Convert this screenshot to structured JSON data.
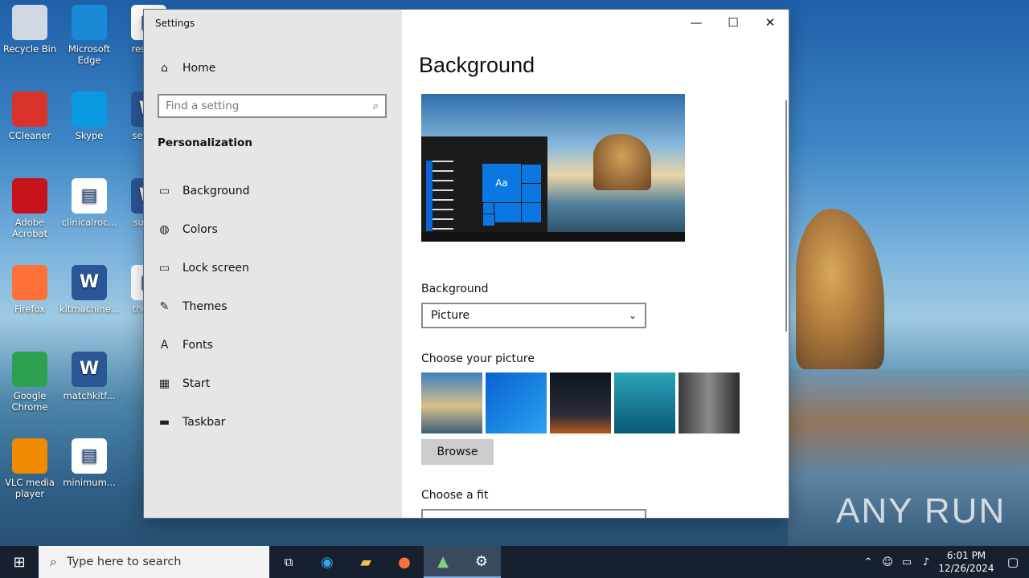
{
  "desktop": {
    "icons": [
      {
        "label": "Recycle Bin",
        "icon": "recycle-bin-icon",
        "color": "#cfd8e3"
      },
      {
        "label": "Microsoft Edge",
        "icon": "edge-icon",
        "color": "#1b8ad6"
      },
      {
        "label": "respe...",
        "icon": "file-icon",
        "color": "#ffffff"
      },
      {
        "label": "CCleaner",
        "icon": "ccleaner-icon",
        "color": "#d9342b"
      },
      {
        "label": "Skype",
        "icon": "skype-icon",
        "color": "#0a9ae2"
      },
      {
        "label": "secur...",
        "icon": "word-icon",
        "color": "#2b5797"
      },
      {
        "label": "Adobe Acrobat",
        "icon": "acrobat-icon",
        "color": "#c7141a"
      },
      {
        "label": "clinicalroc...",
        "icon": "image-file-icon",
        "color": "#ffffff"
      },
      {
        "label": "supp...",
        "icon": "word-icon",
        "color": "#2b5797"
      },
      {
        "label": "Firefox",
        "icon": "firefox-icon",
        "color": "#ff7139"
      },
      {
        "label": "kitmachine...",
        "icon": "word-icon",
        "color": "#2b5797"
      },
      {
        "label": "thurs...",
        "icon": "file-icon",
        "color": "#ffffff"
      },
      {
        "label": "Google Chrome",
        "icon": "chrome-icon",
        "color": "#2da14f"
      },
      {
        "label": "matchkitf...",
        "icon": "word-icon",
        "color": "#2b5797"
      },
      {
        "label": "VLC media player",
        "icon": "vlc-icon",
        "color": "#f08a00"
      },
      {
        "label": "minimum...",
        "icon": "image-file-icon",
        "color": "#ffffff"
      }
    ]
  },
  "window": {
    "title": "Settings",
    "controls": {
      "minimize": "—",
      "maximize": "☐",
      "close": "✕"
    }
  },
  "sidebar": {
    "home": "Home",
    "search_placeholder": "Find a setting",
    "section": "Personalization",
    "items": [
      {
        "label": "Background",
        "icon": "picture-icon",
        "glyph": "▭"
      },
      {
        "label": "Colors",
        "icon": "palette-icon",
        "glyph": "◍"
      },
      {
        "label": "Lock screen",
        "icon": "lock-screen-icon",
        "glyph": "▭"
      },
      {
        "label": "Themes",
        "icon": "themes-icon",
        "glyph": "✎"
      },
      {
        "label": "Fonts",
        "icon": "fonts-icon",
        "glyph": "A"
      },
      {
        "label": "Start",
        "icon": "start-icon",
        "glyph": "▦"
      },
      {
        "label": "Taskbar",
        "icon": "taskbar-icon",
        "glyph": "▬"
      }
    ]
  },
  "main": {
    "heading": "Background",
    "preview_tile_text": "Aa",
    "background_label": "Background",
    "background_value": "Picture",
    "choose_picture_label": "Choose your picture",
    "thumbnails": [
      {
        "name": "beach-rock-thumbnail",
        "bg": "linear-gradient(180deg,#3f7fbf,#d8c08a 55%,#3b5f7a)"
      },
      {
        "name": "windows-blue-thumbnail",
        "bg": "linear-gradient(135deg,#0a60d0,#29a3f2)"
      },
      {
        "name": "night-sky-thumbnail",
        "bg": "linear-gradient(180deg,#0d1420,#2a2d3a 70%,#b75a1a)"
      },
      {
        "name": "underwater-thumbnail",
        "bg": "linear-gradient(180deg,#2aa3b8,#0b5877)"
      },
      {
        "name": "rock-cliff-thumbnail",
        "bg": "linear-gradient(90deg,#3b3b3b,#8a8a8a,#2b2b2b)"
      }
    ],
    "browse_label": "Browse",
    "fit_label": "Choose a fit"
  },
  "taskbar": {
    "search_placeholder": "Type here to search",
    "pinned": [
      "task-view-icon",
      "edge-icon",
      "file-explorer-icon",
      "firefox-icon",
      "app-icon",
      "settings-icon"
    ],
    "time": "6:01 PM",
    "date": "12/26/2024"
  },
  "watermark": "ANY RUN"
}
